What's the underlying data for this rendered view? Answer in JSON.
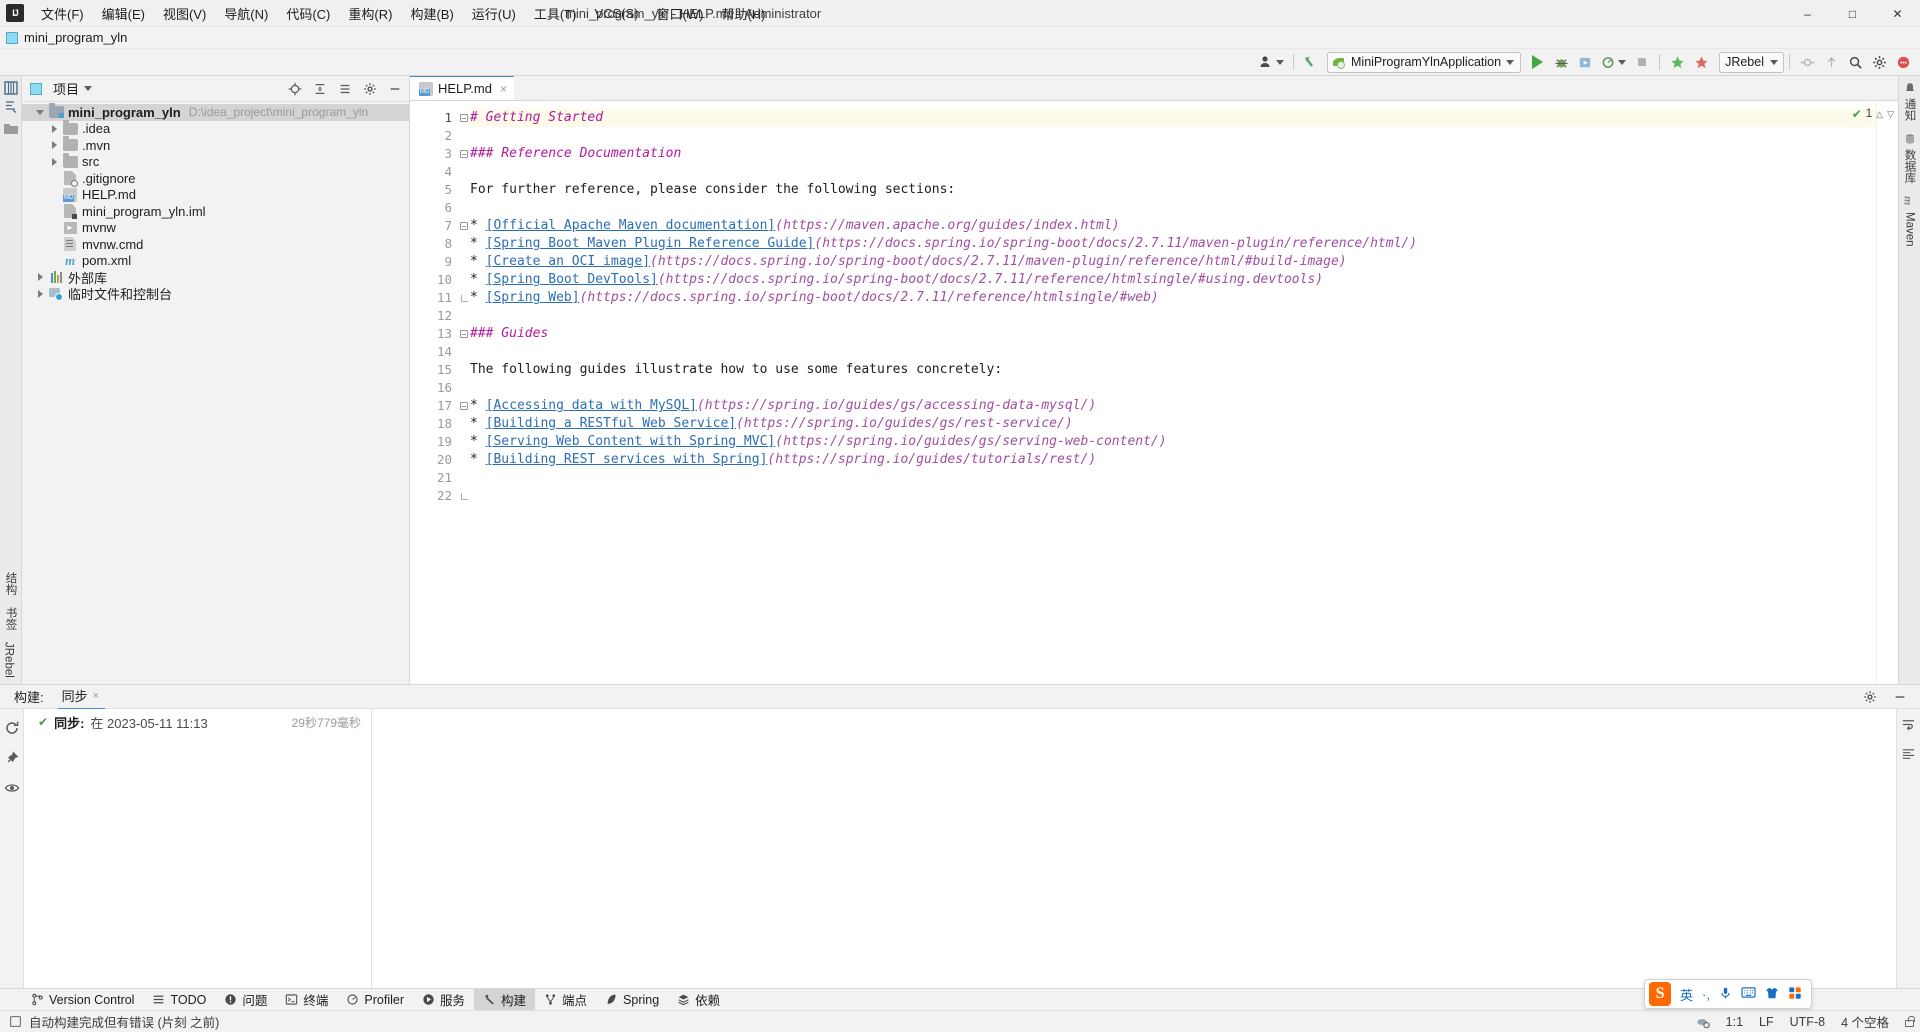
{
  "titlebar": {
    "app_icon": "intellij-logo",
    "menus": [
      "文件(F)",
      "编辑(E)",
      "视图(V)",
      "导航(N)",
      "代码(C)",
      "重构(R)",
      "构建(B)",
      "运行(U)",
      "工具(T)",
      "VCS(S)",
      "窗口(W)",
      "帮助(H)"
    ],
    "window_title": "mini_program_yln - HELP.md - Administrator",
    "window_buttons": [
      "minimize",
      "maximize",
      "close"
    ]
  },
  "project_bar": {
    "name": "mini_program_yln"
  },
  "toolbar": {
    "profiler_label": "",
    "run_config": "MiniProgramYlnApplication",
    "jrebel_label": "JRebel",
    "accent": "#4a88c7",
    "run_color": "#44a544"
  },
  "left_strip": {
    "tabs": [
      "项目",
      "结构",
      "书签",
      "JRebel"
    ]
  },
  "right_strip": {
    "tabs": [
      "通知",
      "数据库",
      "Maven"
    ]
  },
  "project_panel": {
    "title": "项目",
    "tree": [
      {
        "label": "mini_program_yln",
        "path": "D:\\idea_project\\mini_program_yln",
        "icon": "folder-project-icon",
        "state": "expanded",
        "depth": 0,
        "selected": true,
        "bold": true
      },
      {
        "label": ".idea",
        "path": "",
        "icon": "folder-icon",
        "state": "collapsed",
        "depth": 1,
        "selected": false,
        "bold": false
      },
      {
        "label": ".mvn",
        "path": "",
        "icon": "folder-icon",
        "state": "collapsed",
        "depth": 1,
        "selected": false,
        "bold": false
      },
      {
        "label": "src",
        "path": "",
        "icon": "folder-icon",
        "state": "collapsed",
        "depth": 1,
        "selected": false,
        "bold": false
      },
      {
        "label": ".gitignore",
        "path": "",
        "icon": "gitignore-file-icon",
        "state": "leaf",
        "depth": 1,
        "selected": false,
        "bold": false
      },
      {
        "label": "HELP.md",
        "path": "",
        "icon": "markdown-file-icon",
        "state": "leaf",
        "depth": 1,
        "selected": false,
        "bold": false
      },
      {
        "label": "mini_program_yln.iml",
        "path": "",
        "icon": "iml-file-icon",
        "state": "leaf",
        "depth": 1,
        "selected": false,
        "bold": false
      },
      {
        "label": "mvnw",
        "path": "",
        "icon": "script-file-icon",
        "state": "leaf",
        "depth": 1,
        "selected": false,
        "bold": false
      },
      {
        "label": "mvnw.cmd",
        "path": "",
        "icon": "cmd-file-icon",
        "state": "leaf",
        "depth": 1,
        "selected": false,
        "bold": false
      },
      {
        "label": "pom.xml",
        "path": "",
        "icon": "maven-pom-icon",
        "state": "leaf",
        "depth": 1,
        "selected": false,
        "bold": false
      },
      {
        "label": "外部库",
        "path": "",
        "icon": "external-libraries-icon",
        "state": "collapsed",
        "depth": 0,
        "selected": false,
        "bold": false
      },
      {
        "label": "临时文件和控制台",
        "path": "",
        "icon": "scratches-icon",
        "state": "collapsed",
        "depth": 0,
        "selected": false,
        "bold": false
      }
    ]
  },
  "editor": {
    "tab": {
      "label": "HELP.md",
      "icon": "markdown-file-icon",
      "close": "×"
    },
    "inspection": {
      "count": "1",
      "check": "✔"
    },
    "lines": [
      {
        "n": 1,
        "fold": "start",
        "current": true,
        "spans": [
          {
            "t": "# Getting Started",
            "c": "hdr"
          }
        ]
      },
      {
        "n": 2,
        "fold": "",
        "current": false,
        "spans": []
      },
      {
        "n": 3,
        "fold": "start",
        "current": false,
        "spans": [
          {
            "t": "### Reference Documentation",
            "c": "hdr"
          }
        ]
      },
      {
        "n": 4,
        "fold": "",
        "current": false,
        "spans": []
      },
      {
        "n": 5,
        "fold": "",
        "current": false,
        "spans": [
          {
            "t": "For further reference, please consider the following sections:",
            "c": "plain"
          }
        ]
      },
      {
        "n": 6,
        "fold": "",
        "current": false,
        "spans": []
      },
      {
        "n": 7,
        "fold": "start",
        "current": false,
        "spans": [
          {
            "t": "* ",
            "c": "bullet"
          },
          {
            "t": "[Official Apache Maven documentation]",
            "c": "link"
          },
          {
            "t": "(https://maven.apache.org/guides/index.html)",
            "c": "url"
          }
        ]
      },
      {
        "n": 8,
        "fold": "",
        "current": false,
        "spans": [
          {
            "t": "* ",
            "c": "bullet"
          },
          {
            "t": "[Spring Boot Maven Plugin Reference Guide]",
            "c": "link"
          },
          {
            "t": "(https://docs.spring.io/spring-boot/docs/2.7.11/maven-plugin/reference/html/)",
            "c": "url"
          }
        ]
      },
      {
        "n": 9,
        "fold": "",
        "current": false,
        "spans": [
          {
            "t": "* ",
            "c": "bullet"
          },
          {
            "t": "[Create an OCI image]",
            "c": "link"
          },
          {
            "t": "(https://docs.spring.io/spring-boot/docs/2.7.11/maven-plugin/reference/html/#build-image)",
            "c": "url"
          }
        ]
      },
      {
        "n": 10,
        "fold": "",
        "current": false,
        "spans": [
          {
            "t": "* ",
            "c": "bullet"
          },
          {
            "t": "[Spring Boot DevTools]",
            "c": "link"
          },
          {
            "t": "(https://docs.spring.io/spring-boot/docs/2.7.11/reference/htmlsingle/#using.devtools)",
            "c": "url"
          }
        ]
      },
      {
        "n": 11,
        "fold": "end",
        "current": false,
        "spans": [
          {
            "t": "* ",
            "c": "bullet"
          },
          {
            "t": "[Spring Web]",
            "c": "link"
          },
          {
            "t": "(https://docs.spring.io/spring-boot/docs/2.7.11/reference/htmlsingle/#web)",
            "c": "url"
          }
        ]
      },
      {
        "n": 12,
        "fold": "",
        "current": false,
        "spans": []
      },
      {
        "n": 13,
        "fold": "start",
        "current": false,
        "spans": [
          {
            "t": "### Guides",
            "c": "hdr"
          }
        ]
      },
      {
        "n": 14,
        "fold": "",
        "current": false,
        "spans": []
      },
      {
        "n": 15,
        "fold": "",
        "current": false,
        "spans": [
          {
            "t": "The following guides illustrate how to use some features concretely:",
            "c": "plain"
          }
        ]
      },
      {
        "n": 16,
        "fold": "",
        "current": false,
        "spans": []
      },
      {
        "n": 17,
        "fold": "start",
        "current": false,
        "spans": [
          {
            "t": "* ",
            "c": "bullet"
          },
          {
            "t": "[Accessing data with MySQL]",
            "c": "link"
          },
          {
            "t": "(https://spring.io/guides/gs/accessing-data-mysql/)",
            "c": "url"
          }
        ]
      },
      {
        "n": 18,
        "fold": "",
        "current": false,
        "spans": [
          {
            "t": "* ",
            "c": "bullet"
          },
          {
            "t": "[Building a RESTful Web Service]",
            "c": "link"
          },
          {
            "t": "(https://spring.io/guides/gs/rest-service/)",
            "c": "url"
          }
        ]
      },
      {
        "n": 19,
        "fold": "",
        "current": false,
        "spans": [
          {
            "t": "* ",
            "c": "bullet"
          },
          {
            "t": "[Serving Web Content with Spring MVC]",
            "c": "link"
          },
          {
            "t": "(https://spring.io/guides/gs/serving-web-content/)",
            "c": "url"
          }
        ]
      },
      {
        "n": 20,
        "fold": "",
        "current": false,
        "spans": [
          {
            "t": "* ",
            "c": "bullet"
          },
          {
            "t": "[Building REST services with Spring]",
            "c": "link"
          },
          {
            "t": "(https://spring.io/guides/tutorials/rest/)",
            "c": "url"
          }
        ]
      },
      {
        "n": 21,
        "fold": "",
        "current": false,
        "spans": []
      },
      {
        "n": 22,
        "fold": "end",
        "current": false,
        "spans": []
      }
    ]
  },
  "build_panel": {
    "title": "构建:",
    "tab": "同步",
    "tab_close": "×",
    "row": {
      "status_icon": "✔",
      "name": "同步:",
      "when": "在 2023-05-11 11:13",
      "duration": "29秒779毫秒"
    }
  },
  "tool_strip": {
    "items": [
      {
        "label": "Version Control",
        "icon": "branch-icon",
        "selected": false
      },
      {
        "label": "TODO",
        "icon": "list-icon",
        "selected": false
      },
      {
        "label": "问题",
        "icon": "warning-icon",
        "selected": false
      },
      {
        "label": "终端",
        "icon": "terminal-icon",
        "selected": false
      },
      {
        "label": "Profiler",
        "icon": "profiler-icon",
        "selected": false
      },
      {
        "label": "服务",
        "icon": "services-icon",
        "selected": false
      },
      {
        "label": "构建",
        "icon": "build-hammer-icon",
        "selected": true
      },
      {
        "label": "端点",
        "icon": "endpoints-icon",
        "selected": false
      },
      {
        "label": "Spring",
        "icon": "spring-leaf-icon",
        "selected": false
      },
      {
        "label": "依赖",
        "icon": "dependencies-icon",
        "selected": false
      }
    ]
  },
  "ime": {
    "logo": "S",
    "items": [
      "英",
      "·,",
      "mic-icon",
      "keyboard-icon",
      "skin-icon",
      "apps-icon"
    ]
  },
  "statusbar": {
    "message": "自动构建完成但有错误 (片刻 之前)",
    "caret_position": "1:1",
    "line_separator": "LF",
    "encoding": "UTF-8",
    "indent": "4 个空格",
    "lock": "read-only-lock-icon"
  }
}
